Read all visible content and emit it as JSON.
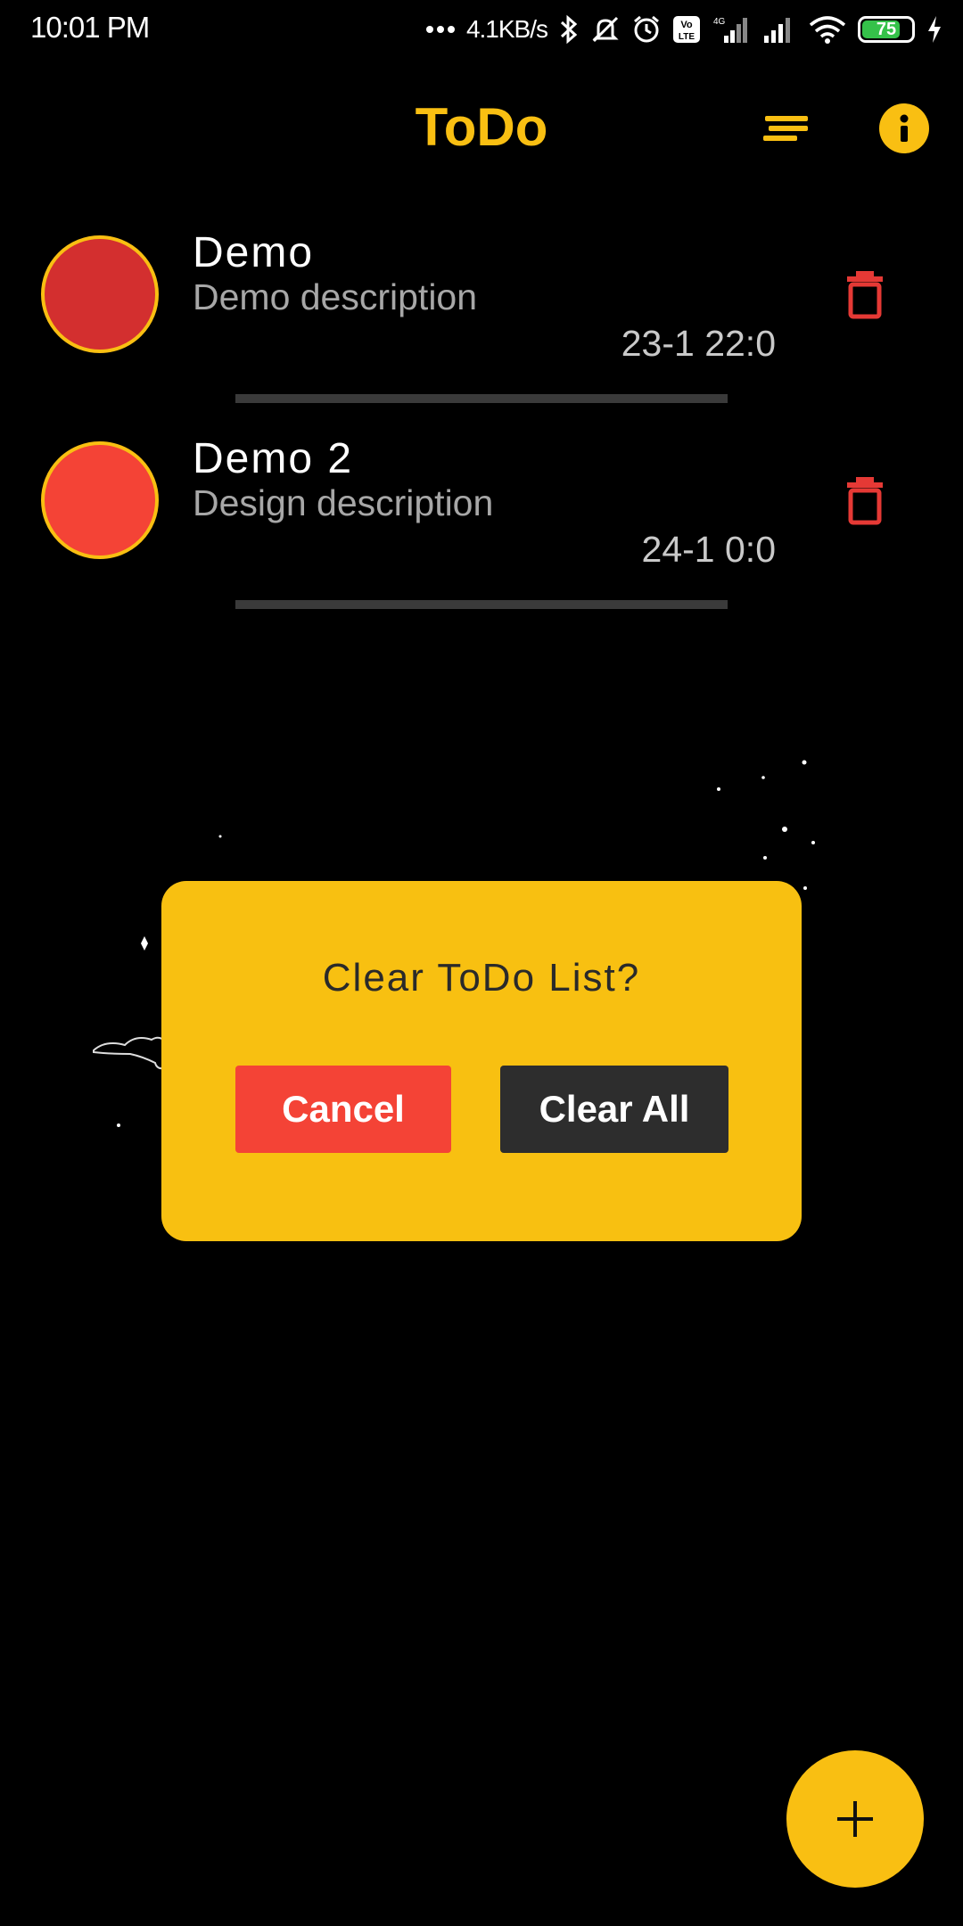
{
  "status_bar": {
    "time": "10:01 PM",
    "network_speed": "4.1KB/s",
    "battery_level": "75",
    "icons": [
      "dots-icon",
      "bluetooth-icon",
      "mute-icon",
      "alarm-icon",
      "volte-icon",
      "signal-4g-icon",
      "signal-icon",
      "wifi-icon",
      "battery-icon",
      "charging-icon"
    ]
  },
  "app_bar": {
    "title": "ToDo",
    "sort_icon": "sort-icon",
    "info_icon": "info-icon"
  },
  "todos": [
    {
      "title": "Demo",
      "description": "Demo description",
      "date": "23-1 22:0",
      "color": "#d32f2f"
    },
    {
      "title": "Demo 2",
      "description": "Design description",
      "date": "24-1 0:0",
      "color": "#f44336"
    }
  ],
  "dialog": {
    "title": "Clear ToDo List?",
    "cancel_label": "Cancel",
    "confirm_label": "Clear All"
  },
  "fab": {
    "icon": "plus-icon"
  },
  "colors": {
    "accent": "#f9bf12",
    "danger": "#f44336",
    "dark_button": "#2d2d2d",
    "background": "#000000"
  }
}
